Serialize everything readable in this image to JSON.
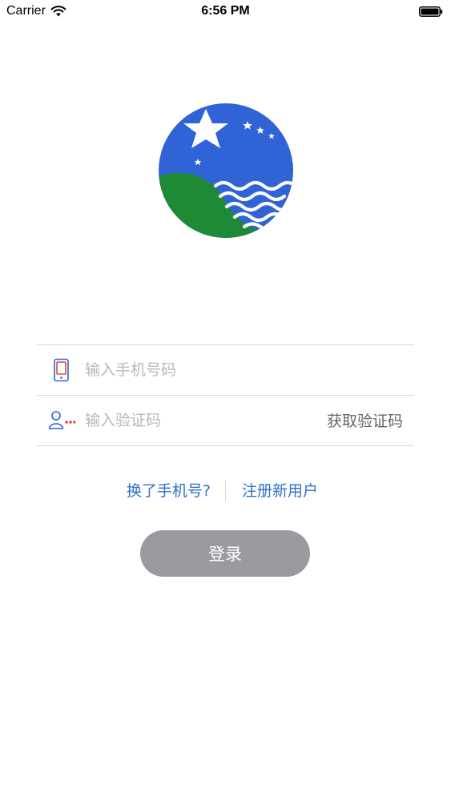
{
  "status_bar": {
    "carrier": "Carrier",
    "time": "6:56 PM",
    "wifi_icon": "wifi-icon",
    "battery_icon": "battery-icon"
  },
  "logo": {
    "icon": "star-sea-emblem",
    "colors": {
      "sky": "#2f63d6",
      "land": "#1f8a36",
      "waves": "#ffffff"
    }
  },
  "form": {
    "phone": {
      "icon": "phone-icon",
      "value": "",
      "placeholder": "输入手机号码"
    },
    "code": {
      "icon": "user-code-icon",
      "value": "",
      "placeholder": "输入验证码",
      "get_code_label": "获取验证码"
    }
  },
  "links": {
    "change_phone": "换了手机号?",
    "register": "注册新用户",
    "link_color": "#2f6fc9"
  },
  "login": {
    "label": "登录",
    "background": "#9b9a9f"
  }
}
